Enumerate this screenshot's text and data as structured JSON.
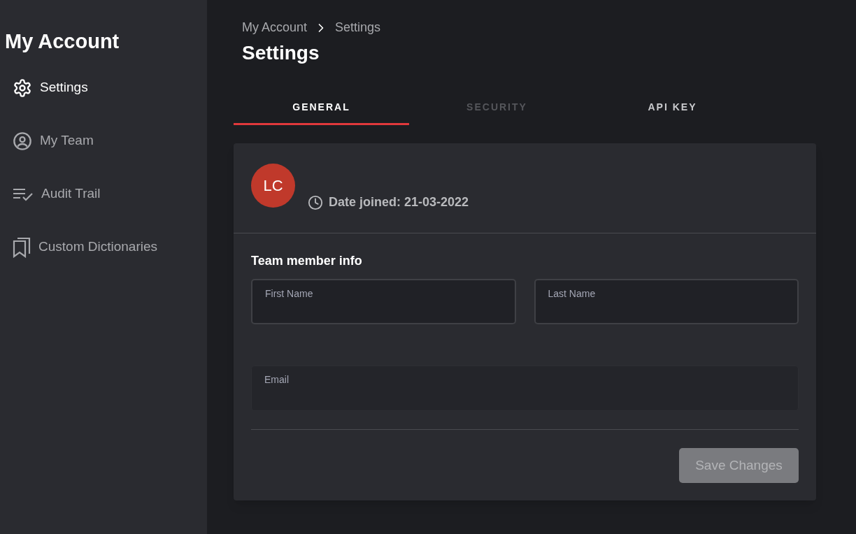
{
  "sidebar": {
    "title": "My Account",
    "items": [
      {
        "label": "Settings",
        "selected": true
      },
      {
        "label": "My Team",
        "selected": false
      },
      {
        "label": "Audit Trail",
        "selected": false
      },
      {
        "label": "Custom Dictionaries",
        "selected": false
      }
    ]
  },
  "breadcrumb": [
    "My Account",
    "Settings"
  ],
  "page_title": "Settings",
  "tabs": [
    {
      "label": "GENERAL",
      "selected": true,
      "disabled": false
    },
    {
      "label": "SECURITY",
      "selected": false,
      "disabled": true
    },
    {
      "label": "API KEY",
      "selected": false,
      "disabled": false
    }
  ],
  "profile": {
    "initials": "LC",
    "date_joined": "Date joined: 21-03-2022"
  },
  "section_title": "Team member info",
  "fields": [
    {
      "label": "First Name",
      "disabled": false
    },
    {
      "label": "Last Name",
      "disabled": false
    },
    {
      "label": "Email",
      "disabled": true
    }
  ],
  "save_button": {
    "label": "Save Changes",
    "disabled": true
  }
}
